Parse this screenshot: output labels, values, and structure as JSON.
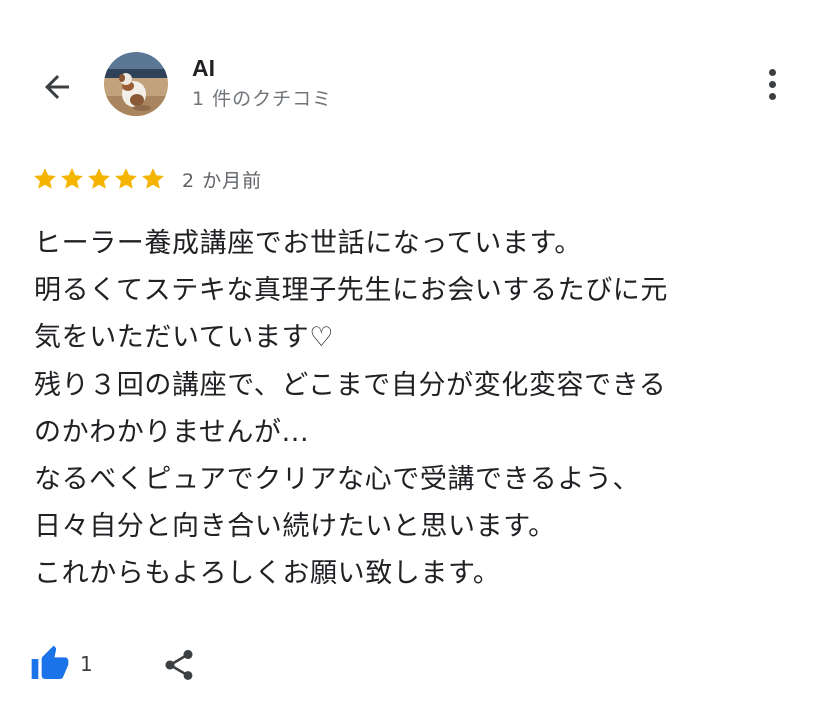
{
  "header": {
    "back_icon": "arrow-left-icon",
    "author_name": "AI",
    "review_count": "1 件のクチコミ",
    "more_icon": "more-vertical-icon"
  },
  "review": {
    "rating": 5,
    "rating_max": 5,
    "star_color": "#F4B400",
    "date": "2 か月前",
    "lines": [
      "ヒーラー養成講座でお世話になっています。",
      "明るくてステキな真理子先生にお会いするたびに元",
      "気をいただいています♡",
      "残り３回の講座で、どこまで自分が変化変容できる",
      "のかわかりませんが...",
      "なるべくピュアでクリアな心で受講できるよう、",
      "日々自分と向き合い続けたいと思います。",
      "これからもよろしくお願い致します。"
    ]
  },
  "actions": {
    "like_icon": "thumbs-up-icon",
    "like_count": "1",
    "like_color": "#1A73E8",
    "share_icon": "share-icon"
  }
}
